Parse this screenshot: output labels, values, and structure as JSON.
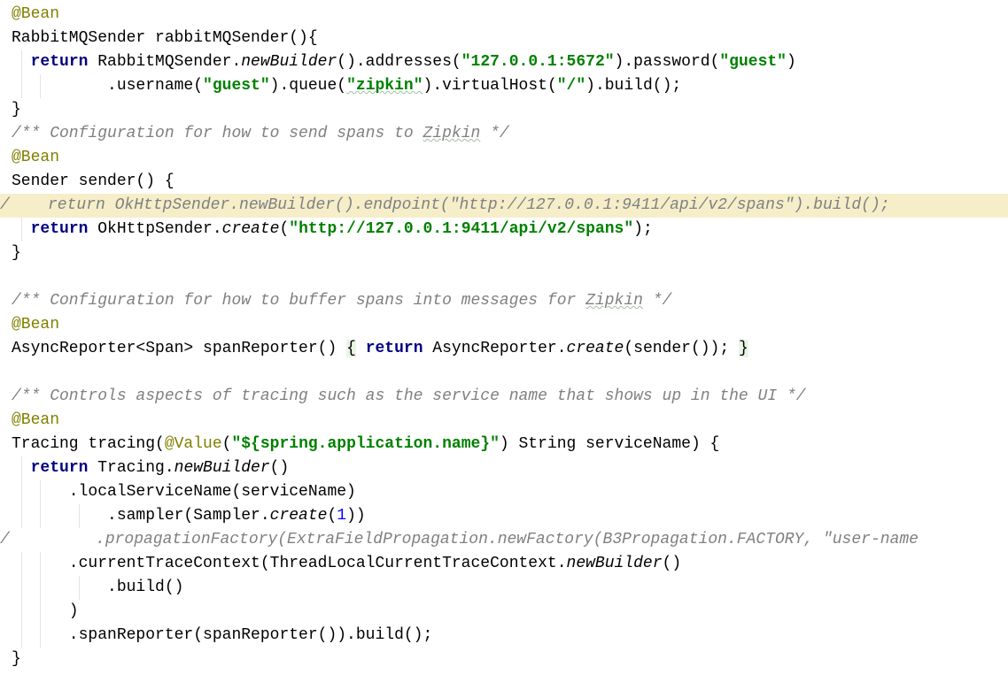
{
  "editor": {
    "lines": [
      {
        "segments": [
          {
            "text": "@Bean",
            "cls": "t-ann"
          }
        ]
      },
      {
        "segments": [
          {
            "text": "RabbitMQSender rabbitMQSender(){"
          }
        ]
      },
      {
        "guides": [
          1
        ],
        "segments": [
          {
            "text": "  "
          },
          {
            "text": "return",
            "cls": "t-kw"
          },
          {
            "text": " RabbitMQSender."
          },
          {
            "text": "newBuilder",
            "cls": "t-it"
          },
          {
            "text": "().addresses("
          },
          {
            "text": "\"127.0.0.1:5672\"",
            "cls": "t-str"
          },
          {
            "text": ").password("
          },
          {
            "text": "\"guest\"",
            "cls": "t-str"
          },
          {
            "text": ")"
          }
        ]
      },
      {
        "guides": [
          1,
          3
        ],
        "segments": [
          {
            "text": "          .username("
          },
          {
            "text": "\"guest\"",
            "cls": "t-str"
          },
          {
            "text": ").queue("
          },
          {
            "text": "\"zipkin\"",
            "cls": "t-str typo"
          },
          {
            "text": ").virtualHost("
          },
          {
            "text": "\"/\"",
            "cls": "t-str"
          },
          {
            "text": ").build();"
          }
        ]
      },
      {
        "segments": [
          {
            "text": "}"
          }
        ]
      },
      {
        "segments": [
          {
            "text": "/** Configuration for how to send spans to ",
            "cls": "t-com"
          },
          {
            "text": "Zipkin",
            "cls": "t-com typo"
          },
          {
            "text": " */",
            "cls": "t-com"
          }
        ]
      },
      {
        "segments": [
          {
            "text": "@Bean",
            "cls": "t-ann"
          }
        ]
      },
      {
        "segments": [
          {
            "text": "Sender sender() {"
          }
        ]
      },
      {
        "highlight": true,
        "segments": [
          {
            "text": "/    return OkHttpSender.newBuilder().endpoint(\"http://127.0.0.1:9411/api/v2/spans\").build();",
            "cls": "t-com"
          }
        ]
      },
      {
        "guides": [
          1
        ],
        "segments": [
          {
            "text": "  "
          },
          {
            "text": "return",
            "cls": "t-kw"
          },
          {
            "text": " OkHttpSender."
          },
          {
            "text": "create",
            "cls": "t-it"
          },
          {
            "text": "("
          },
          {
            "text": "\"http://127.0.0.1:9411/api/v2/spans\"",
            "cls": "t-str"
          },
          {
            "text": ");"
          }
        ]
      },
      {
        "segments": [
          {
            "text": "}"
          }
        ]
      },
      {
        "segments": []
      },
      {
        "segments": [
          {
            "text": "/** Configuration for how to buffer spans into messages for ",
            "cls": "t-com"
          },
          {
            "text": "Zipkin",
            "cls": "t-com typo"
          },
          {
            "text": " */",
            "cls": "t-com"
          }
        ]
      },
      {
        "segments": [
          {
            "text": "@Bean",
            "cls": "t-ann"
          }
        ]
      },
      {
        "segments": [
          {
            "text": "AsyncReporter<Span> spanReporter() "
          },
          {
            "text": "{",
            "cls": "t-brace"
          },
          {
            "text": " "
          },
          {
            "text": "return",
            "cls": "t-kw"
          },
          {
            "text": " AsyncReporter."
          },
          {
            "text": "create",
            "cls": "t-it"
          },
          {
            "text": "(sender()); "
          },
          {
            "text": "}",
            "cls": "t-brace"
          }
        ]
      },
      {
        "segments": []
      },
      {
        "segments": [
          {
            "text": "/** Controls aspects of tracing such as the service name that shows up in the UI */",
            "cls": "t-com"
          }
        ]
      },
      {
        "segments": [
          {
            "text": "@Bean",
            "cls": "t-ann"
          }
        ]
      },
      {
        "segments": [
          {
            "text": "Tracing tracing("
          },
          {
            "text": "@Value",
            "cls": "t-ann"
          },
          {
            "text": "("
          },
          {
            "text": "\"${spring.application.name}\"",
            "cls": "t-str"
          },
          {
            "text": ") String serviceName) {"
          }
        ]
      },
      {
        "guides": [
          1
        ],
        "segments": [
          {
            "text": "  "
          },
          {
            "text": "return",
            "cls": "t-kw"
          },
          {
            "text": " Tracing."
          },
          {
            "text": "newBuilder",
            "cls": "t-it"
          },
          {
            "text": "()"
          }
        ]
      },
      {
        "guides": [
          1,
          3
        ],
        "segments": [
          {
            "text": "      .localServiceName(serviceName)"
          }
        ]
      },
      {
        "guides": [
          1,
          3,
          7
        ],
        "segments": [
          {
            "text": "          .sampler(Sampler."
          },
          {
            "text": "create",
            "cls": "t-it"
          },
          {
            "text": "("
          },
          {
            "text": "1",
            "cls": "t-num"
          },
          {
            "text": "))"
          }
        ]
      },
      {
        "segments": [
          {
            "text": "/         .propagationFactory(ExtraFieldPropagation.newFactory(B3Propagation.FACTORY, \"user-name",
            "cls": "t-com"
          }
        ]
      },
      {
        "guides": [
          1,
          3
        ],
        "segments": [
          {
            "text": "      .currentTraceContext(ThreadLocalCurrentTraceContext."
          },
          {
            "text": "newBuilder",
            "cls": "t-it"
          },
          {
            "text": "()"
          }
        ]
      },
      {
        "guides": [
          1,
          3,
          7
        ],
        "segments": [
          {
            "text": "          .build()"
          }
        ]
      },
      {
        "guides": [
          1,
          3
        ],
        "segments": [
          {
            "text": "      )"
          }
        ]
      },
      {
        "guides": [
          1,
          3
        ],
        "segments": [
          {
            "text": "      .spanReporter(spanReporter()).build();"
          }
        ]
      },
      {
        "segments": [
          {
            "text": "}"
          }
        ]
      }
    ]
  }
}
